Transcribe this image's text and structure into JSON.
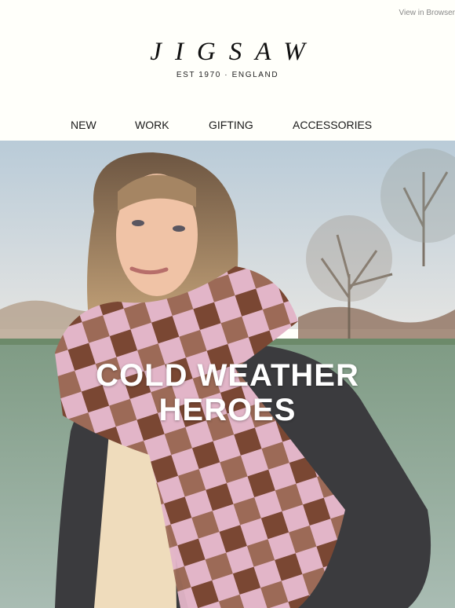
{
  "header": {
    "view_in_browser": "View in Browser",
    "brand": "JIGSAW",
    "tagline": "EST 1970 · ENGLAND"
  },
  "nav": {
    "items": [
      {
        "label": "NEW"
      },
      {
        "label": "WORK"
      },
      {
        "label": "GIFTING"
      },
      {
        "label": "ACCESSORIES"
      }
    ]
  },
  "hero": {
    "title_line1": "COLD WEATHER",
    "title_line2": "HEROES"
  },
  "colors": {
    "background": "#fffffa",
    "scarf_pink": "#e3b6c9",
    "scarf_brown": "#7b4a35",
    "coat": "#3c3c3e",
    "field": "#8ca89a"
  }
}
